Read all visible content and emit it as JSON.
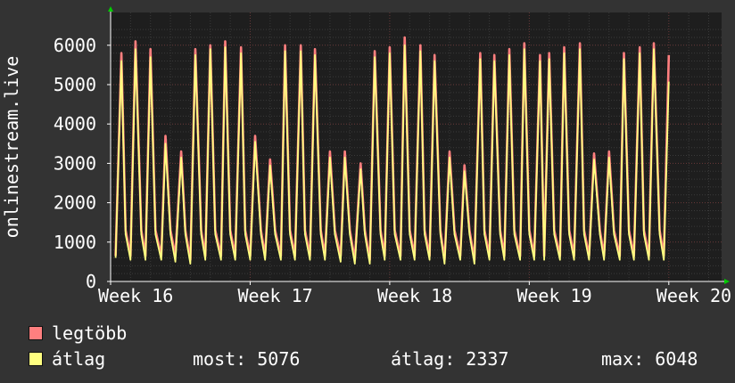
{
  "chart_data": {
    "type": "line",
    "ylabel": "onlinestream.live",
    "ylim": [
      0,
      6500
    ],
    "y_ticks": [
      "0",
      "1000",
      "2000",
      "3000",
      "4000",
      "5000",
      "6000"
    ],
    "x_ticks": [
      "Week 16",
      "Week 17",
      "Week 18",
      "Week 19",
      "Week 20"
    ],
    "grid": true,
    "series": [
      {
        "name": "legtöbb",
        "color": "#ff7f7f",
        "x_days": [
          0.25,
          0.54,
          0.75,
          1.0,
          1.25,
          1.54,
          1.75,
          2.0,
          2.25,
          2.54,
          2.75,
          3.0,
          3.25,
          3.54,
          3.75,
          4.0,
          4.25,
          4.54,
          4.75,
          5.0,
          5.25,
          5.54,
          5.75,
          6.0,
          6.25,
          6.54,
          6.75,
          7.0,
          7.25,
          7.54,
          7.75,
          8.0,
          8.25,
          8.54,
          8.75,
          9.0,
          9.25,
          9.54,
          9.75,
          10.0,
          10.25,
          10.54,
          10.75,
          11.0,
          11.25,
          11.54,
          11.75,
          12.0,
          12.25,
          12.54,
          12.75,
          13.0,
          13.25,
          13.54,
          13.75,
          14.0,
          14.25,
          14.54,
          14.75,
          15.0,
          15.25,
          15.54,
          15.75,
          16.0,
          16.25,
          16.54,
          16.75,
          17.0,
          17.25,
          17.54,
          17.75,
          18.0,
          18.25,
          18.54,
          18.75,
          19.0,
          19.25,
          19.54,
          19.75,
          20.0,
          20.25,
          20.54,
          20.75,
          21.0,
          21.25,
          21.54,
          21.75,
          22.0,
          22.25,
          22.54,
          22.75,
          23.0,
          23.25,
          23.54,
          23.75,
          24.0,
          24.25,
          24.54,
          24.75,
          25.0,
          25.25,
          25.54,
          25.75,
          26.0,
          26.25,
          26.54,
          26.75,
          27.0,
          27.25,
          27.54,
          27.75,
          28.0,
          28.25,
          28.54
        ],
        "values": [
          650,
          5800,
          1300,
          650,
          6100,
          1300,
          650,
          5900,
          1300,
          650,
          3700,
          1300,
          650,
          3300,
          1300,
          550,
          5900,
          1300,
          650,
          6000,
          1300,
          650,
          6100,
          1300,
          650,
          5950,
          1300,
          650,
          3700,
          1300,
          650,
          3100,
          1300,
          650,
          6000,
          1300,
          650,
          6000,
          1300,
          650,
          5900,
          1300,
          650,
          3300,
          1300,
          650,
          3300,
          1300,
          550,
          3000,
          1300,
          550,
          5850,
          1300,
          650,
          5950,
          1300,
          650,
          6200,
          1300,
          650,
          6000,
          1300,
          650,
          5750,
          1300,
          550,
          3300,
          1300,
          650,
          2950,
          1300,
          550,
          5800,
          1300,
          650,
          5750,
          1300,
          650,
          5900,
          1300,
          650,
          6050,
          1300,
          650,
          5750,
          650,
          5800,
          1300,
          650,
          5950,
          1300,
          650,
          6050,
          1300,
          650,
          3250,
          1300,
          650,
          3300,
          1300,
          650,
          5800,
          1300,
          650,
          5950,
          1300,
          650,
          6050,
          1300,
          650,
          5750
        ]
      },
      {
        "name": "átlag",
        "color": "#ffff80",
        "x_days": [
          0.25,
          0.54,
          0.75,
          1.0,
          1.25,
          1.54,
          1.75,
          2.0,
          2.25,
          2.54,
          2.75,
          3.0,
          3.25,
          3.54,
          3.75,
          4.0,
          4.25,
          4.54,
          4.75,
          5.0,
          5.25,
          5.54,
          5.75,
          6.0,
          6.25,
          6.54,
          6.75,
          7.0,
          7.25,
          7.54,
          7.75,
          8.0,
          8.25,
          8.54,
          8.75,
          9.0,
          9.25,
          9.54,
          9.75,
          10.0,
          10.25,
          10.54,
          10.75,
          11.0,
          11.25,
          11.54,
          11.75,
          12.0,
          12.25,
          12.54,
          12.75,
          13.0,
          13.25,
          13.54,
          13.75,
          14.0,
          14.25,
          14.54,
          14.75,
          15.0,
          15.25,
          15.54,
          15.75,
          16.0,
          16.25,
          16.54,
          16.75,
          17.0,
          17.25,
          17.54,
          17.75,
          18.0,
          18.25,
          18.54,
          18.75,
          19.0,
          19.25,
          19.54,
          19.75,
          20.0,
          20.25,
          20.54,
          20.75,
          21.0,
          21.25,
          21.54,
          21.75,
          22.0,
          22.25,
          22.54,
          22.75,
          23.0,
          23.25,
          23.54,
          23.75,
          24.0,
          24.25,
          24.54,
          24.75,
          25.0,
          25.25,
          25.54,
          25.75,
          26.0,
          26.25,
          26.54,
          26.75,
          27.0,
          27.25,
          27.54,
          27.75,
          28.0,
          28.25,
          28.54
        ],
        "values": [
          600,
          5600,
          1200,
          550,
          5900,
          1200,
          550,
          5700,
          1200,
          550,
          3500,
          1200,
          500,
          3150,
          1200,
          450,
          5750,
          1200,
          550,
          5900,
          1200,
          550,
          5950,
          1200,
          550,
          5800,
          1200,
          550,
          3550,
          1200,
          550,
          2950,
          1200,
          550,
          5850,
          1200,
          550,
          5850,
          1200,
          550,
          5750,
          1200,
          550,
          3150,
          1200,
          500,
          3150,
          1200,
          450,
          2850,
          1200,
          450,
          5700,
          1200,
          550,
          5800,
          1200,
          550,
          6000,
          1200,
          550,
          5850,
          1200,
          550,
          5600,
          1200,
          450,
          3150,
          1200,
          550,
          2800,
          1200,
          450,
          5650,
          1200,
          550,
          5600,
          1200,
          550,
          5750,
          1200,
          550,
          5900,
          1200,
          550,
          5600,
          550,
          5650,
          1200,
          550,
          5800,
          1200,
          550,
          5900,
          1200,
          550,
          3100,
          1200,
          550,
          3150,
          1200,
          550,
          5650,
          1200,
          550,
          5800,
          1200,
          550,
          5900,
          1200,
          550,
          5076
        ]
      }
    ]
  },
  "legend": {
    "max_label": "legtöbb",
    "avg_label": "átlag",
    "max_color": "#ff7f7f",
    "avg_color": "#ffff80",
    "stat_now": "most: 5076",
    "stat_avg": "átlag: 2337",
    "stat_max": "max: 6048"
  }
}
